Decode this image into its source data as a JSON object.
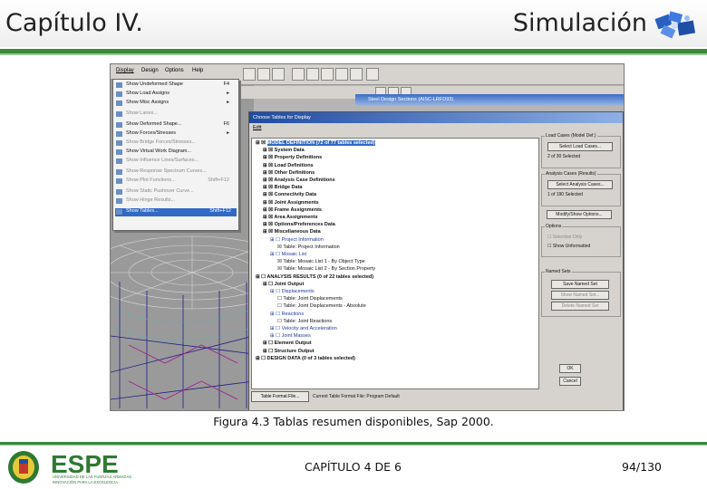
{
  "header": {
    "left_title": "Capítulo IV.",
    "right_title": "Simulación"
  },
  "app": {
    "menubar": [
      "Display",
      "Design",
      "Options",
      "Help"
    ],
    "menu_items": [
      {
        "label": "Show Undeformed Shape",
        "shortcut": "F4",
        "dim": false,
        "selected": false
      },
      {
        "label": "Show Load Assigns",
        "shortcut": "▸",
        "dim": false,
        "selected": false
      },
      {
        "label": "Show Misc Assigns",
        "shortcut": "▸",
        "dim": false,
        "selected": false
      },
      {
        "label": "Show Lanes...",
        "shortcut": "",
        "dim": true,
        "selected": false
      },
      {
        "label": "Show Deformed Shape...",
        "shortcut": "F6",
        "dim": false,
        "selected": false
      },
      {
        "label": "Show Forces/Stresses",
        "shortcut": "▸",
        "dim": false,
        "selected": false
      },
      {
        "label": "Show Bridge Forces/Stresses...",
        "shortcut": "",
        "dim": true,
        "selected": false
      },
      {
        "label": "Show Virtual Work Diagram...",
        "shortcut": "",
        "dim": false,
        "selected": false
      },
      {
        "label": "Show Influence Lines/Surfaces...",
        "shortcut": "",
        "dim": true,
        "selected": false
      },
      {
        "label": "Show Response Spectrum Curves...",
        "shortcut": "",
        "dim": true,
        "selected": false
      },
      {
        "label": "Show Plot Functions...",
        "shortcut": "Shift+F12",
        "dim": true,
        "selected": false
      },
      {
        "label": "Show Static Pushover Curve...",
        "shortcut": "",
        "dim": true,
        "selected": false
      },
      {
        "label": "Show Hinge Results...",
        "shortcut": "",
        "dim": true,
        "selected": false
      },
      {
        "label": "Show Tables...",
        "shortcut": "Shift+F12",
        "dim": false,
        "selected": true
      }
    ],
    "steel_window_title": "Steel Design Sections (AISC-LRFD93)",
    "dialog": {
      "title": "Choose Tables for Display",
      "edit_menu": "Edit",
      "tree": [
        {
          "indent": 0,
          "text": "MODEL DEFINITION  (72 of 77 tables selected)",
          "hl": true,
          "bold": true,
          "blue": false
        },
        {
          "indent": 1,
          "text": "System Data",
          "hl": false,
          "bold": true,
          "blue": false
        },
        {
          "indent": 1,
          "text": "Property Definitions",
          "hl": false,
          "bold": true,
          "blue": false
        },
        {
          "indent": 1,
          "text": "Load Definitions",
          "hl": false,
          "bold": true,
          "blue": false
        },
        {
          "indent": 1,
          "text": "Other Definitions",
          "hl": false,
          "bold": true,
          "blue": false
        },
        {
          "indent": 1,
          "text": "Analysis Case Definitions",
          "hl": false,
          "bold": true,
          "blue": false
        },
        {
          "indent": 1,
          "text": "Bridge Data",
          "hl": false,
          "bold": true,
          "blue": false
        },
        {
          "indent": 1,
          "text": "Connectivity Data",
          "hl": false,
          "bold": true,
          "blue": false
        },
        {
          "indent": 1,
          "text": "Joint Assignments",
          "hl": false,
          "bold": true,
          "blue": false
        },
        {
          "indent": 1,
          "text": "Frame Assignments",
          "hl": false,
          "bold": true,
          "blue": false
        },
        {
          "indent": 1,
          "text": "Area Assignments",
          "hl": false,
          "bold": true,
          "blue": false
        },
        {
          "indent": 1,
          "text": "Options/Preferences Data",
          "hl": false,
          "bold": true,
          "blue": false
        },
        {
          "indent": 1,
          "text": "Miscellaneous Data",
          "hl": false,
          "bold": true,
          "blue": false
        },
        {
          "indent": 2,
          "text": "Project Information",
          "hl": false,
          "bold": false,
          "blue": true
        },
        {
          "indent": 3,
          "text": "Table: Project Information",
          "hl": false,
          "bold": false,
          "blue": false
        },
        {
          "indent": 2,
          "text": "Mosaic List",
          "hl": false,
          "bold": false,
          "blue": true
        },
        {
          "indent": 3,
          "text": "Table: Mosaic List 1 - By Object Type",
          "hl": false,
          "bold": false,
          "blue": false
        },
        {
          "indent": 3,
          "text": "Table: Mosaic List 2 - By Section Property",
          "hl": false,
          "bold": false,
          "blue": false
        },
        {
          "indent": 0,
          "text": "ANALYSIS RESULTS  (0 of 22 tables selected)",
          "hl": false,
          "bold": true,
          "blue": false
        },
        {
          "indent": 1,
          "text": "Joint Output",
          "hl": false,
          "bold": true,
          "blue": false
        },
        {
          "indent": 2,
          "text": "Displacements",
          "hl": false,
          "bold": false,
          "blue": true
        },
        {
          "indent": 3,
          "text": "Table: Joint Displacements",
          "hl": false,
          "bold": false,
          "blue": false
        },
        {
          "indent": 3,
          "text": "Table: Joint Displacements - Absolute",
          "hl": false,
          "bold": false,
          "blue": false
        },
        {
          "indent": 2,
          "text": "Reactions",
          "hl": false,
          "bold": false,
          "blue": true
        },
        {
          "indent": 3,
          "text": "Table: Joint Reactions",
          "hl": false,
          "bold": false,
          "blue": false
        },
        {
          "indent": 2,
          "text": "Velocity and Acceleration",
          "hl": false,
          "bold": false,
          "blue": true
        },
        {
          "indent": 2,
          "text": "Joint Masses",
          "hl": false,
          "bold": false,
          "blue": true
        },
        {
          "indent": 1,
          "text": "Element Output",
          "hl": false,
          "bold": true,
          "blue": false
        },
        {
          "indent": 1,
          "text": "Structure Output",
          "hl": false,
          "bold": true,
          "blue": false
        },
        {
          "indent": 0,
          "text": "DESIGN DATA  (0 of 3 tables selected)",
          "hl": false,
          "bold": true,
          "blue": false
        }
      ],
      "load_cases_title": "Load Cases (Model Def.)",
      "select_load_cases": "Select Load Cases...",
      "load_cases_selected": "2 of 30 Selected",
      "analysis_cases_title": "Analysis Cases (Results)",
      "select_analysis_cases": "Select Analysis Cases...",
      "analysis_cases_selected": "1 of 190 Selected",
      "modify_show_options": "Modify/Show Options...",
      "options_title": "Options",
      "selection_only": "Selection Only",
      "show_unformatted": "Show Unformatted",
      "named_sets_title": "Named Sets",
      "save_named_set": "Save Named Set",
      "show_named_set": "Show Named Set...",
      "delete_named_set": "Delete Named Set",
      "ok": "OK",
      "cancel": "Cancel",
      "table_format_file": "Table Format File...",
      "current_format": "Current Table Format File:  Program Default"
    }
  },
  "caption": "Figura 4.3 Tablas resumen disponibles, Sap 2000.",
  "footer": {
    "logo_text": "ESPE",
    "logo_sub1": "UNIVERSIDAD DE LAS FUERZAS ARMADAS",
    "logo_sub2": "INNOVACIÓN PARA LA EXCELENCIA",
    "center": "CAPÍTULO 4 DE 6",
    "page": "94/130"
  }
}
